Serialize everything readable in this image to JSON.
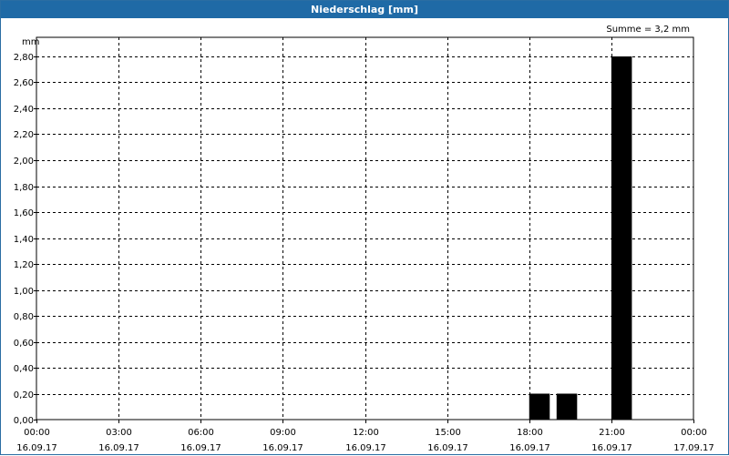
{
  "window": {
    "title": "Niederschlag [mm]"
  },
  "summary": {
    "text": "Summe = 3,2 mm"
  },
  "chart_data": {
    "type": "bar",
    "title": "Niederschlag [mm]",
    "ylabel": "mm",
    "ylim": [
      0,
      2.8
    ],
    "yticks": [
      0,
      0.2,
      0.4,
      0.6,
      0.8,
      1.0,
      1.2,
      1.4,
      1.6,
      1.8,
      2.0,
      2.2,
      2.4,
      2.6,
      2.8
    ],
    "ytick_labels": [
      "0,00",
      "0,20",
      "0,40",
      "0,60",
      "0,80",
      "1,00",
      "1,20",
      "1,40",
      "1,60",
      "1,80",
      "2,00",
      "2,20",
      "2,40",
      "2,60",
      "2,80"
    ],
    "xlim_hours": [
      0,
      24
    ],
    "xticks_hours": [
      0,
      3,
      6,
      9,
      12,
      15,
      18,
      21,
      24
    ],
    "xtick_labels": [
      [
        "00:00",
        "16.09.17"
      ],
      [
        "03:00",
        "16.09.17"
      ],
      [
        "06:00",
        "16.09.17"
      ],
      [
        "09:00",
        "16.09.17"
      ],
      [
        "12:00",
        "16.09.17"
      ],
      [
        "15:00",
        "16.09.17"
      ],
      [
        "18:00",
        "16.09.17"
      ],
      [
        "21:00",
        "16.09.17"
      ],
      [
        "00:00",
        "17.09.17"
      ]
    ],
    "bars": [
      {
        "time": "16.09.17 18:00-18:45",
        "value": 0.2
      },
      {
        "time": "16.09.17 19:00-19:45",
        "value": 0.2
      },
      {
        "time": "16.09.17 21:00-21:45",
        "value": 2.8
      }
    ],
    "bar_color": "#000000",
    "grid": true,
    "grid_style": "dashed"
  }
}
